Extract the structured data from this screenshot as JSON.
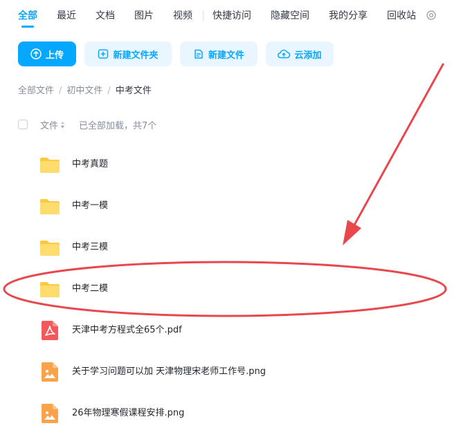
{
  "tabs": [
    {
      "label": "全部",
      "active": true
    },
    {
      "label": "最近",
      "active": false
    },
    {
      "label": "文档",
      "active": false
    },
    {
      "label": "图片",
      "active": false
    },
    {
      "label": "视频",
      "active": false
    },
    {
      "label": "快捷访问",
      "active": false
    },
    {
      "label": "隐藏空间",
      "active": false
    },
    {
      "label": "我的分享",
      "active": false
    },
    {
      "label": "回收站",
      "active": false
    }
  ],
  "toolbar": {
    "upload_label": "上传",
    "new_folder_label": "新建文件夹",
    "new_file_label": "新建文件",
    "cloud_add_label": "云添加"
  },
  "breadcrumb": [
    {
      "label": "全部文件"
    },
    {
      "label": "初中文件"
    },
    {
      "label": "中考文件"
    }
  ],
  "breadcrumb_separator": "/",
  "list_header": {
    "column_name": "文件",
    "status": "已全部加载，共7个"
  },
  "files": [
    {
      "name": "中考真题",
      "type": "folder",
      "icon": "folder-icon"
    },
    {
      "name": "中考一模",
      "type": "folder",
      "icon": "folder-icon"
    },
    {
      "name": "中考三模",
      "type": "folder",
      "icon": "folder-icon"
    },
    {
      "name": "中考二模",
      "type": "folder",
      "icon": "folder-icon",
      "highlighted": true
    },
    {
      "name": "天津中考方程式全65个.pdf",
      "type": "pdf",
      "icon": "pdf-icon"
    },
    {
      "name": "关于学习问题可以加 天津物理宋老师工作号.png",
      "type": "image",
      "icon": "image-icon"
    },
    {
      "name": "26年物理寒假课程安排.png",
      "type": "image",
      "icon": "image-icon"
    }
  ],
  "colors": {
    "accent": "#06a7ff",
    "accent_light": "#eaf6ff",
    "folder": "#ffd45c",
    "pdf": "#f2595b",
    "image": "#f8a24a",
    "annotation": "#e8474c"
  }
}
